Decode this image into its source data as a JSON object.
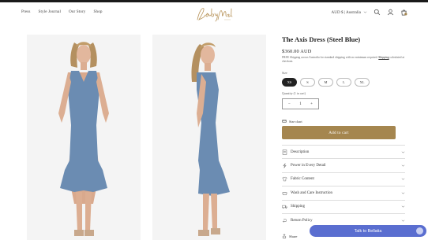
{
  "nav": {
    "items": [
      "Press",
      "Style Journal",
      "Our Story",
      "Shop"
    ]
  },
  "brand": {
    "logo_text": "Lady Melbourne"
  },
  "header": {
    "locale": "AUD $ | Australia"
  },
  "product": {
    "title": "The Axis Dress (Steel Blue)",
    "price": "$360.00 AUD",
    "shipping_line1": "FREE Shipping across Australia for standard shipping with no minimum required.",
    "shipping_link": "Shipping",
    "shipping_line2": "calculated at checkout.",
    "size_label": "Size",
    "sizes": [
      "XS",
      "S",
      "M",
      "L",
      "XL"
    ],
    "selected_size": "XS",
    "quantity_label": "Quantity (1 in cart)",
    "quantity": "1",
    "size_chart": "Size chart",
    "add_to_cart": "Add to cart"
  },
  "accordion": [
    {
      "label": "Description",
      "icon": "description-icon"
    },
    {
      "label": "Power in Every Detail",
      "icon": "power-icon"
    },
    {
      "label": "Fabric Content",
      "icon": "fabric-icon"
    },
    {
      "label": "Wash and Care Instruction",
      "icon": "care-icon"
    },
    {
      "label": "Shipping",
      "icon": "truck-icon"
    },
    {
      "label": "Return Policy",
      "icon": "return-icon"
    }
  ],
  "share": "Share",
  "chat": {
    "label": "Talk to Bellatia"
  },
  "colors": {
    "accent": "#a5864f",
    "chat": "#5a6ed0",
    "dress": "#6b8cb2"
  }
}
